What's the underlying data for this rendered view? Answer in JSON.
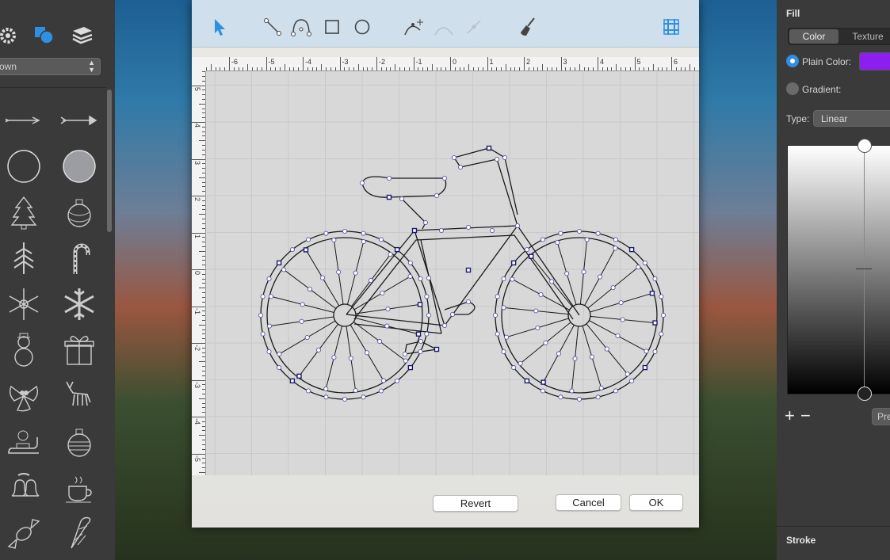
{
  "library": {
    "dropdown_value": "own",
    "icons": [
      "gear-icon",
      "shapes-icon",
      "layers-icon"
    ],
    "items": [
      "arrow-thin-icon",
      "arrow-feather-icon",
      "circle-outline-icon",
      "circle-filled-icon",
      "christmas-tree-icon",
      "ornament-icon",
      "pine-tree-icon",
      "candy-cane-icon",
      "snowflake-icon",
      "snowflake-solid-icon",
      "snowman-icon",
      "gift-icon",
      "holly-icon",
      "reindeer-icon",
      "sleigh-icon",
      "ornament-striped-icon",
      "bells-icon",
      "coffee-cup-icon",
      "candy-icon",
      "ice-cream-icon"
    ]
  },
  "toolbar": {
    "tools": [
      "select-arrow-icon",
      "line-tool-icon",
      "bezier-tool-icon",
      "rectangle-tool-icon",
      "ellipse-tool-icon",
      "add-point-icon",
      "remove-point-icon",
      "convert-point-icon",
      "brush-icon",
      "grid-icon"
    ],
    "accent": "#2f8fe0"
  },
  "rulers": {
    "h_labels": [
      "-6",
      "-5",
      "-4",
      "-3",
      "-2",
      "-1",
      "0",
      "1",
      "2",
      "3",
      "4",
      "5",
      "6"
    ],
    "v_labels": [
      "5",
      "4",
      "3",
      "2",
      "1",
      "0",
      "-1",
      "-2",
      "-3",
      "-4",
      "-5"
    ]
  },
  "dialog": {
    "revert_label": "Revert",
    "cancel_label": "Cancel",
    "ok_label": "OK"
  },
  "inspector": {
    "fill_title": "Fill",
    "tab_color": "Color",
    "tab_texture": "Texture",
    "plain_color_label": "Plain Color:",
    "gradient_label": "Gradient:",
    "type_label": "Type:",
    "type_value": "Linear",
    "fill_color": "#8c1ff0",
    "preset_label": "Pre",
    "stroke_title": "Stroke"
  }
}
